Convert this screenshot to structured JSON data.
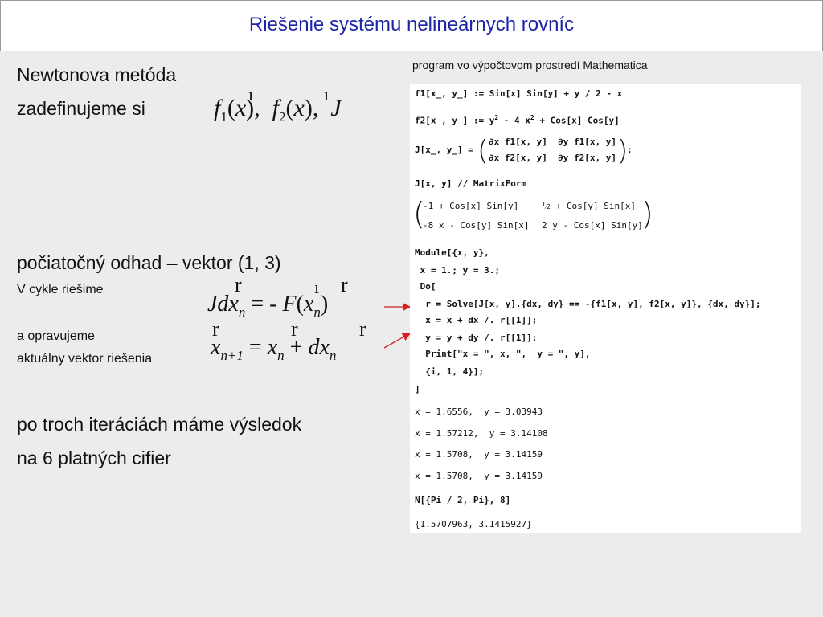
{
  "title": "Riešenie systému nelineárnych rovníc",
  "left": {
    "line1": "Newtonova metóda",
    "line2": "zadefinujeme si",
    "line3": "počiatočný odhad – vektor (1, 3)",
    "line4": "V cykle riešime",
    "line5": "a opravujeme",
    "line6": "aktuálny vektor riešenia",
    "line7": "po troch iteráciách máme výsledok",
    "line8": "na 6 platných cifier"
  },
  "caption": "program vo výpočtovom prostredí Mathematica",
  "code": {
    "f1": "f1[x_, y_] := Sin[x] Sin[y] + y / 2 - x",
    "f2_a": "f2[x_, y_] := y",
    "f2_b": " - 4 x",
    "f2_c": " + Cos[x] Cos[y]",
    "j_def": "J[x_, y_] =",
    "j_r1": "∂x f1[x, y]  ∂y f1[x, y]",
    "j_r2": "∂x f2[x, y]  ∂y f2[x, y]",
    "j_semicolon": ";",
    "matrixform": "J[x, y] // MatrixForm",
    "m11": "-1 + Cos[x] Sin[y]",
    "m12": "+ Cos[y] Sin[x]",
    "m21": "-8 x - Cos[y] Sin[x]",
    "m22": "2 y - Cos[x] Sin[y]",
    "module": "Module[{x, y},",
    "init": " x = 1.; y = 3.;",
    "do": " Do[",
    "solve": "  r = Solve[J[x, y].{dx, dy} == -{f1[x, y], f2[x, y]}, {dx, dy}];",
    "updx": "  x = x + dx /. r[[1]];",
    "updy": "  y = y + dy /. r[[1]];",
    "print": "  Print[\"x = \", x, \",  y = \", y],",
    "iter": "  {i, 1, 4}];",
    "close": "]",
    "out1": "x = 1.6556,  y = 3.03943",
    "out2": "x = 1.57212,  y = 3.14108",
    "out3": "x = 1.5708,  y = 3.14159",
    "out4": "x = 1.5708,  y = 3.14159",
    "npi": "N[{Pi / 2, Pi}, 8]",
    "result": "{1.5707963, 3.1415927}"
  },
  "colors": {
    "title": "#1c24a8",
    "arrow": "#d62020"
  }
}
